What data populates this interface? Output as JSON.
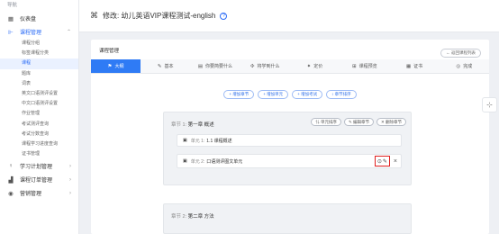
{
  "sidebar": {
    "nav_title": "导航",
    "dashboard": {
      "label": "仪表盘",
      "icon": "grid-icon"
    },
    "course_mgmt": {
      "label": "课程管理",
      "items": [
        "课程分组",
        "标签课程分类",
        "课程",
        "题库",
        "词表",
        "英文口语测评设置",
        "中文口语测评设置",
        "作业管理",
        "考试测评查询",
        "考试分数查询",
        "课程学习进度查询",
        "证书管理"
      ],
      "active_index": 2
    },
    "groups": [
      {
        "label": "学习计划管理",
        "icon": "learn-icon"
      },
      {
        "label": "课程订单管理",
        "icon": "order-icon"
      },
      {
        "label": "营销管理",
        "icon": "marketing-icon"
      }
    ]
  },
  "header": {
    "title": "修改: 幼儿英语VIP课程测试-english",
    "help": "?"
  },
  "card": {
    "title": "课程管理",
    "back_button": "← 返回课程列表",
    "tabs": [
      {
        "label": "大纲",
        "icon": "⚑",
        "active": true
      },
      {
        "label": "基本",
        "icon": "✎",
        "active": false
      },
      {
        "label": "你要简要什么",
        "icon": "▤",
        "active": false
      },
      {
        "label": "将学到什么",
        "icon": "✣",
        "active": false
      },
      {
        "label": "定价",
        "icon": "✦",
        "active": false
      },
      {
        "label": "课程预览",
        "icon": "⊞",
        "active": false
      },
      {
        "label": "证书",
        "icon": "▦",
        "active": false
      },
      {
        "label": "完成",
        "icon": "◎",
        "active": false
      }
    ],
    "actions": [
      "+ 增加章节",
      "+ 增加单元",
      "+ 增加考试",
      "↕ 章节排序"
    ]
  },
  "sections": [
    {
      "label": "章节 1:",
      "title": "第一章 概述",
      "buttons": [
        "⇅ 单元排序",
        "✎ 编辑章节",
        "✕ 删除章节"
      ],
      "units": [
        {
          "label": "单元 1:",
          "title": "1.1 课程概述"
        },
        {
          "label": "单元 2:",
          "title": "口语测评图文单元"
        }
      ]
    },
    {
      "label": "章节 2:",
      "title": "第二章 方法"
    }
  ],
  "colors": {
    "primary": "#2f7bf5",
    "highlight": "#e02020"
  }
}
